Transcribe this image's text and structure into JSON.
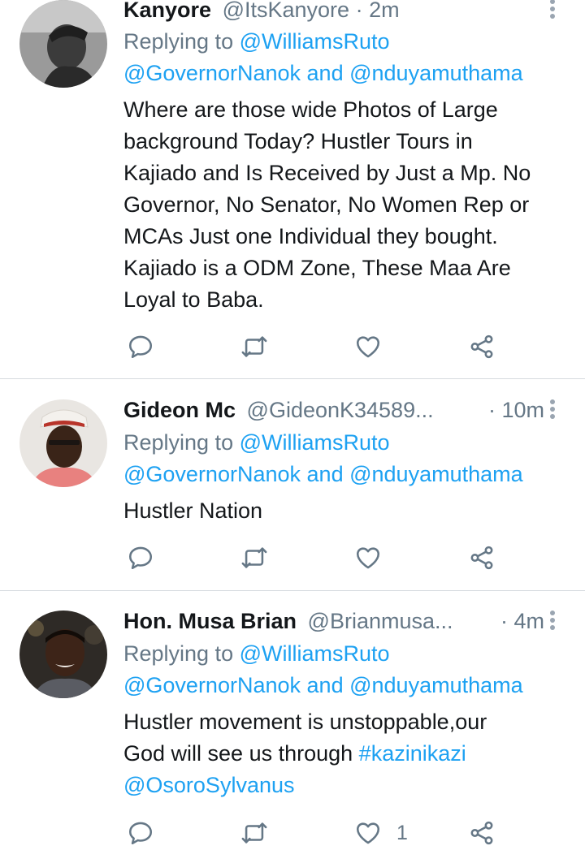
{
  "tweets": [
    {
      "name": "Kanyore",
      "handle": "@ItsKanyore",
      "dot": "·",
      "time": "2m",
      "replying_prefix": "Replying to",
      "replying_to_1": "@WilliamsRuto",
      "replying_to_2": "@GovernorNanok",
      "replying_and": "and",
      "replying_to_3": "@nduyamuthama",
      "body_lines": [
        "Where are those wide Photos of Large",
        "background Today? Hustler Tours in",
        "Kajiado and Is Received by Just a Mp. No",
        "Governor, No Senator, No Women Rep or",
        "MCAs Just one Individual they bought.",
        "Kajiado is a ODM Zone, These Maa Are",
        "Loyal to Baba."
      ],
      "like_count": ""
    },
    {
      "name": "Gideon Mc",
      "handle": "@GideonK34589...",
      "dot": "·",
      "time": "10m",
      "replying_prefix": "Replying to",
      "replying_to_1": "@WilliamsRuto",
      "replying_to_2": "@GovernorNanok",
      "replying_and": "and",
      "replying_to_3": "@nduyamuthama",
      "body_lines": [
        "Hustler Nation"
      ],
      "like_count": ""
    },
    {
      "name": "Hon. Musa Brian",
      "handle": "@Brianmusa...",
      "dot": "·",
      "time": "4m",
      "replying_prefix": "Replying to",
      "replying_to_1": "@WilliamsRuto",
      "replying_to_2": "@GovernorNanok",
      "replying_and": "and",
      "replying_to_3": "@nduyamuthama",
      "body_line_1": "Hustler movement is unstoppable,our",
      "body_line_2_text": "God will see us through",
      "body_line_2_hashtag": "#kazinikazi",
      "body_line_3_mention": "@OsoroSylvanus",
      "like_count": "1"
    }
  ],
  "icons": {
    "reply": "reply-icon",
    "retweet": "retweet-icon",
    "like": "heart-icon",
    "share": "share-icon",
    "more": "more-vertical-icon"
  },
  "colors": {
    "link": "#1da1f2",
    "secondary_text": "#657786",
    "divider": "#d6dbdf",
    "icon": "#657786"
  }
}
